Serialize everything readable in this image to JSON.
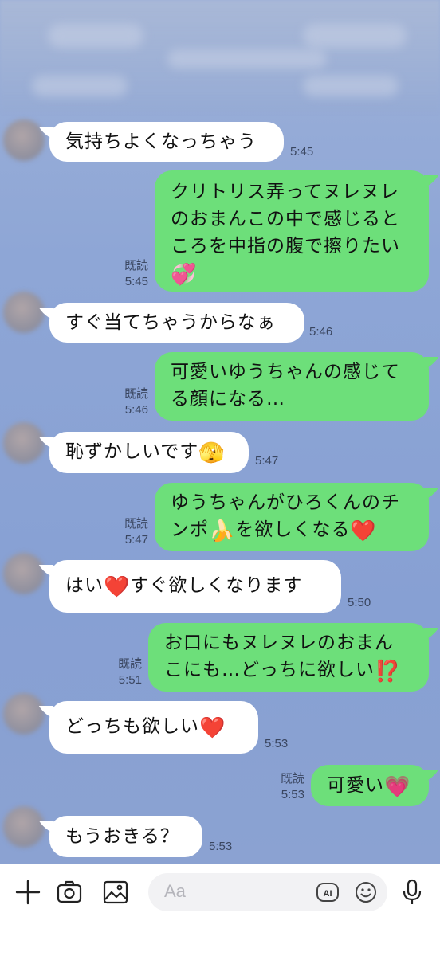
{
  "read_label": "既読",
  "messages": [
    {
      "dir": "in",
      "lines": [
        "気持ちよくなっちゃう"
      ],
      "time": "5:45"
    },
    {
      "dir": "out",
      "lines": [
        "クリトリス弄ってヌレヌレ",
        "のおまんこの中で感じると",
        "ころを中指の腹で擦りたい"
      ],
      "emoji": "💞",
      "time": "5:45",
      "read": true
    },
    {
      "dir": "in",
      "lines": [
        "すぐ当てちゃうからなぁ"
      ],
      "time": "5:46"
    },
    {
      "dir": "out",
      "lines": [
        "可愛いゆうちゃんの感じて",
        "る顔になる…"
      ],
      "time": "5:46",
      "read": true
    },
    {
      "dir": "in",
      "lines": [
        "恥ずかしいです"
      ],
      "emoji": "🫣",
      "time": "5:47"
    },
    {
      "dir": "out",
      "lines": [
        "ゆうちゃんがひろくんのチ",
        "ンポ"
      ],
      "emoji": "🍌",
      "line2_after": "を欲しくなる",
      "emoji2": "❤️",
      "time": "5:47",
      "read": true
    },
    {
      "dir": "in",
      "lines": [
        "はい"
      ],
      "emoji": "❤️",
      "after": "すぐ欲しくなります",
      "time": "5:50"
    },
    {
      "dir": "out",
      "lines": [
        "お口にもヌレヌレのおまん",
        "こにも…どっちに欲しい"
      ],
      "emoji": "⁉️",
      "time": "5:51",
      "read": true
    },
    {
      "dir": "in",
      "lines": [
        "どっちも欲しい"
      ],
      "emoji": "❤️",
      "time": "5:53"
    },
    {
      "dir": "out",
      "lines": [
        "可愛い"
      ],
      "emoji": "💗",
      "time": "5:53",
      "read": true
    },
    {
      "dir": "in",
      "lines": [
        "もうおきる？"
      ],
      "time": "5:53"
    }
  ],
  "composer": {
    "placeholder": "Aa",
    "ai_badge": "AI",
    "icons": [
      "plus-icon",
      "camera-icon",
      "image-icon",
      "ai-icon",
      "smiley-icon",
      "microphone-icon"
    ]
  }
}
